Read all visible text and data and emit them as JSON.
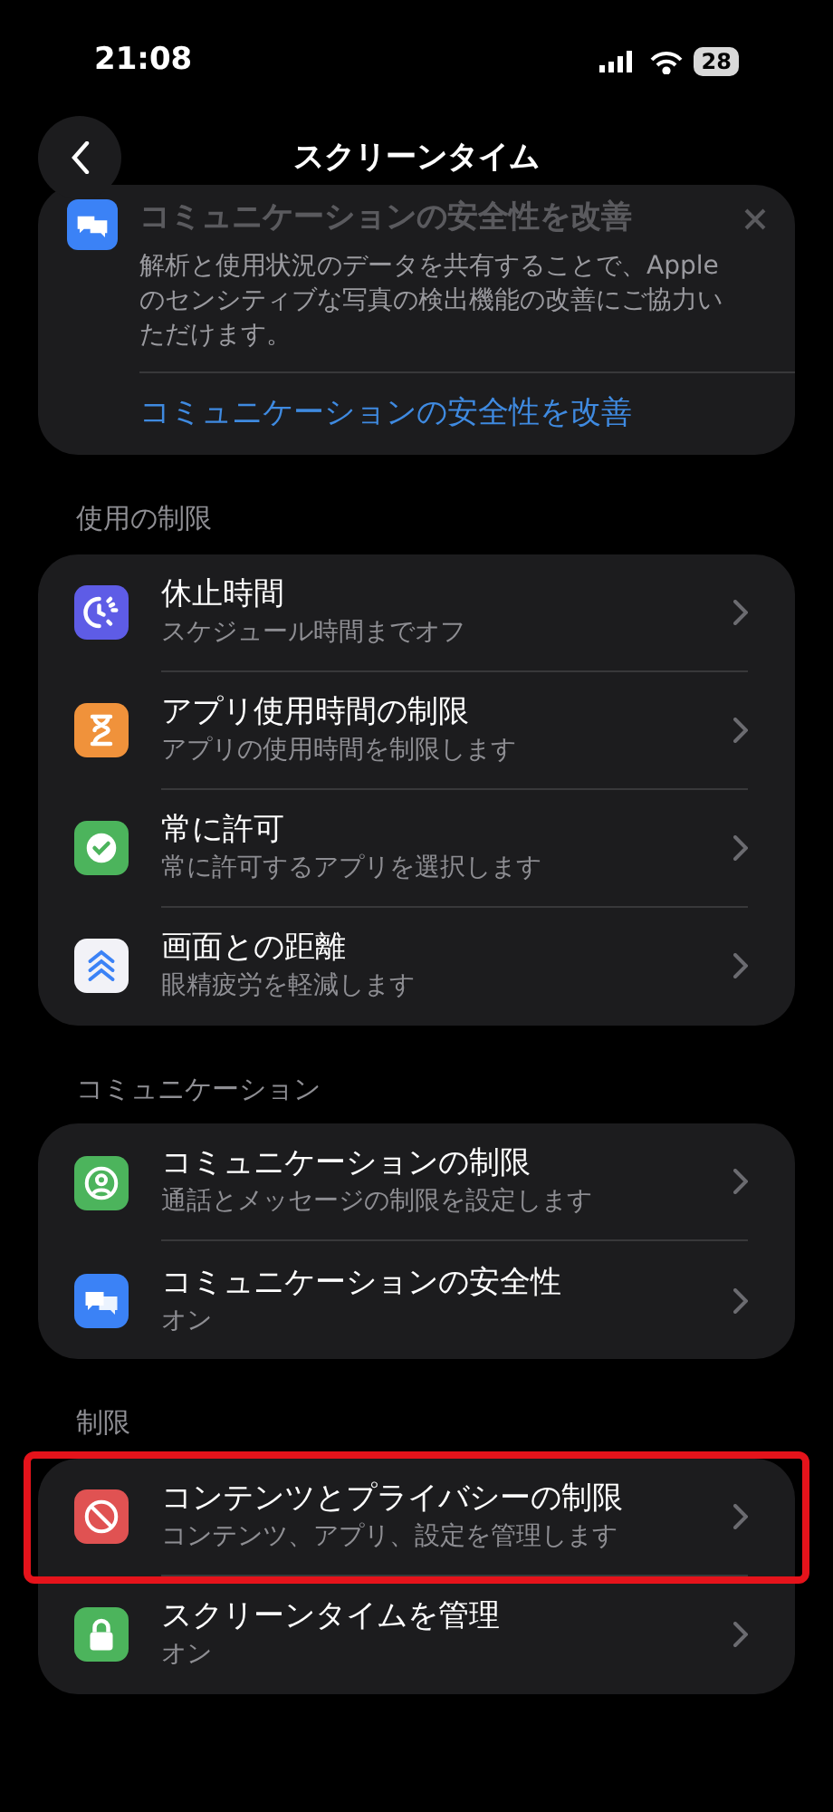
{
  "status_bar": {
    "time": "21:08",
    "battery": "28"
  },
  "nav": {
    "title": "スクリーンタイム"
  },
  "banner": {
    "title": "コミュニケーションの安全性を改善",
    "body": "解析と使用状況のデータを共有することで、Appleのセンシティブな写真の検出機能の改善にご協力いただけます。",
    "link": "コミュニケーションの安全性を改善"
  },
  "sections": [
    {
      "header": "使用の制限",
      "items": [
        {
          "kind": "downtime",
          "title": "休止時間",
          "subtitle": "スケジュール時間までオフ",
          "highlighted": false
        },
        {
          "kind": "hourglass",
          "title": "アプリ使用時間の制限",
          "subtitle": "アプリの使用時間を制限します",
          "highlighted": false
        },
        {
          "kind": "badge",
          "title": "常に許可",
          "subtitle": "常に許可するアプリを選択します",
          "highlighted": false
        },
        {
          "kind": "distance",
          "title": "画面との距離",
          "subtitle": "眼精疲労を軽減します",
          "highlighted": false
        }
      ]
    },
    {
      "header": "コミュニケーション",
      "items": [
        {
          "kind": "contact",
          "title": "コミュニケーションの制限",
          "subtitle": "通話とメッセージの制限を設定します",
          "highlighted": false
        },
        {
          "kind": "bubbles",
          "title": "コミュニケーションの安全性",
          "subtitle": "オン",
          "highlighted": false
        }
      ]
    },
    {
      "header": "制限",
      "items": [
        {
          "kind": "block",
          "title": "コンテンツとプライバシーの制限",
          "subtitle": "コンテンツ、アプリ、設定を管理します",
          "highlighted": true
        },
        {
          "kind": "lock",
          "title": "スクリーンタイムを管理",
          "subtitle": "オン",
          "highlighted": false
        }
      ]
    }
  ]
}
